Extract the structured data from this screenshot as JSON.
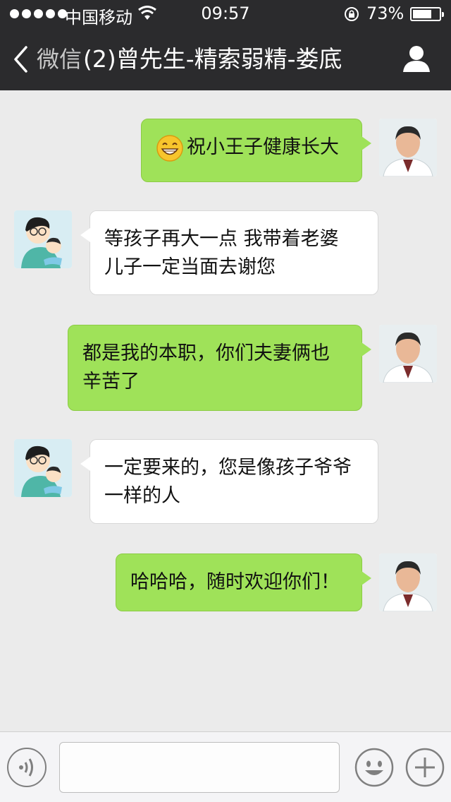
{
  "status_bar": {
    "carrier": "中国移动",
    "time": "09:57",
    "battery_percent_text": "73%",
    "battery_level": 0.73,
    "icons": [
      "signal-dots-icon",
      "wifi-icon",
      "rotation-lock-icon",
      "battery-icon"
    ]
  },
  "nav": {
    "back_label": "微信",
    "title": "(2)曾先生-精索弱精-娄底",
    "icons": [
      "chevron-left-icon",
      "profile-icon"
    ]
  },
  "messages": [
    {
      "side": "out",
      "emoji": "grinning-face-icon",
      "text": "祝小王子健康长大"
    },
    {
      "side": "in",
      "lines": [
        "等孩子再大一点 我带着老婆",
        "儿子一定当面去谢您"
      ]
    },
    {
      "side": "out",
      "lines": [
        "都是我的本职，你们夫妻俩也",
        "辛苦了"
      ]
    },
    {
      "side": "in",
      "lines": [
        "一定要来的，您是像孩子爷爷",
        "一样的人"
      ]
    },
    {
      "side": "out",
      "text": "哈哈哈，随时欢迎你们！"
    }
  ],
  "input_bar": {
    "value": "",
    "icons": [
      "voice-icon",
      "emoji-icon",
      "plus-icon"
    ]
  },
  "colors": {
    "bar_bg": "#2b2b2d",
    "chat_bg": "#ebebeb",
    "outgoing_bubble": "#9fe259",
    "incoming_bubble": "#ffffff"
  }
}
